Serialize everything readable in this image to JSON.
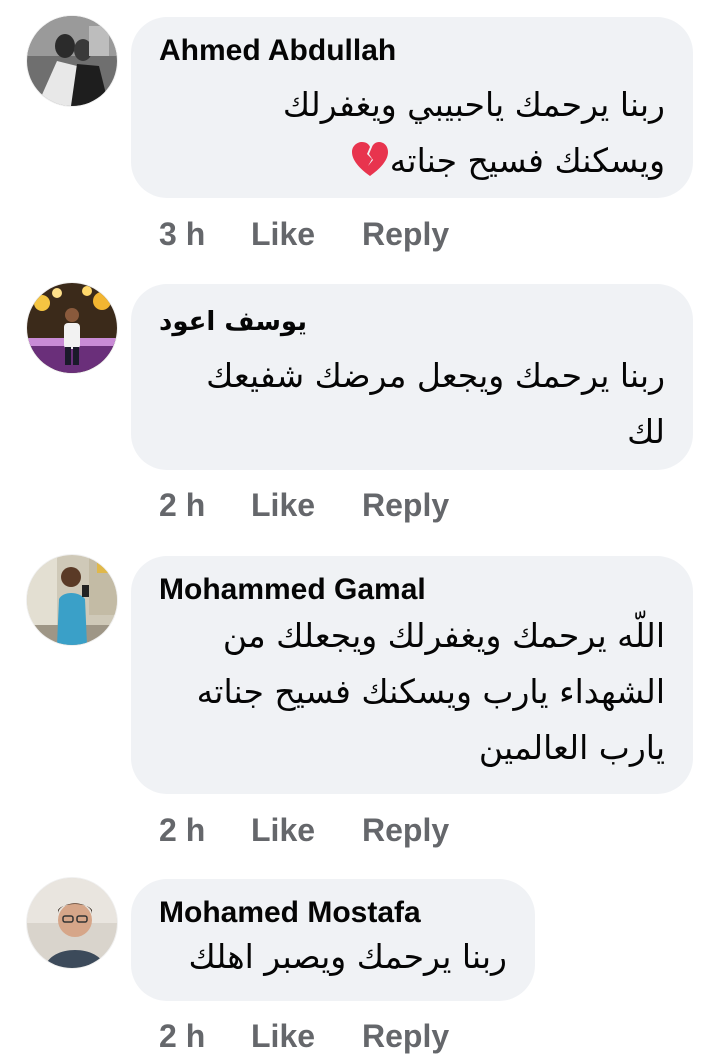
{
  "colors": {
    "bubble": "#f0f2f5",
    "action_text": "#65676b",
    "author_text": "#050505",
    "heart": "#e8344e"
  },
  "comments": [
    {
      "author": "Ahmed Abdullah",
      "lines": [
        "ربنا يرحمك ياحبيبي ويغفرلك",
        "ويسكنك فسيح جناته"
      ],
      "emoji": "broken-heart-icon",
      "time": "3 h",
      "like": "Like",
      "reply": "Reply"
    },
    {
      "author": "يوسف اعود",
      "lines": [
        "ربنا يرحمك ويجعل مرضك شفيعك",
        "لك"
      ],
      "time": "2 h",
      "like": "Like",
      "reply": "Reply"
    },
    {
      "author": "Mohammed Gamal",
      "lines": [
        "اللّه يرحمك ويغفرلك ويجعلك من",
        "الشهداء يارب ويسكنك فسيح جناته",
        "يارب العالمين"
      ],
      "time": "2 h",
      "like": "Like",
      "reply": "Reply"
    },
    {
      "author": "Mohamed Mostafa",
      "lines": [
        "ربنا يرحمك ويصبر اهلك"
      ],
      "time": "2 h",
      "like": "Like",
      "reply": "Reply"
    }
  ]
}
